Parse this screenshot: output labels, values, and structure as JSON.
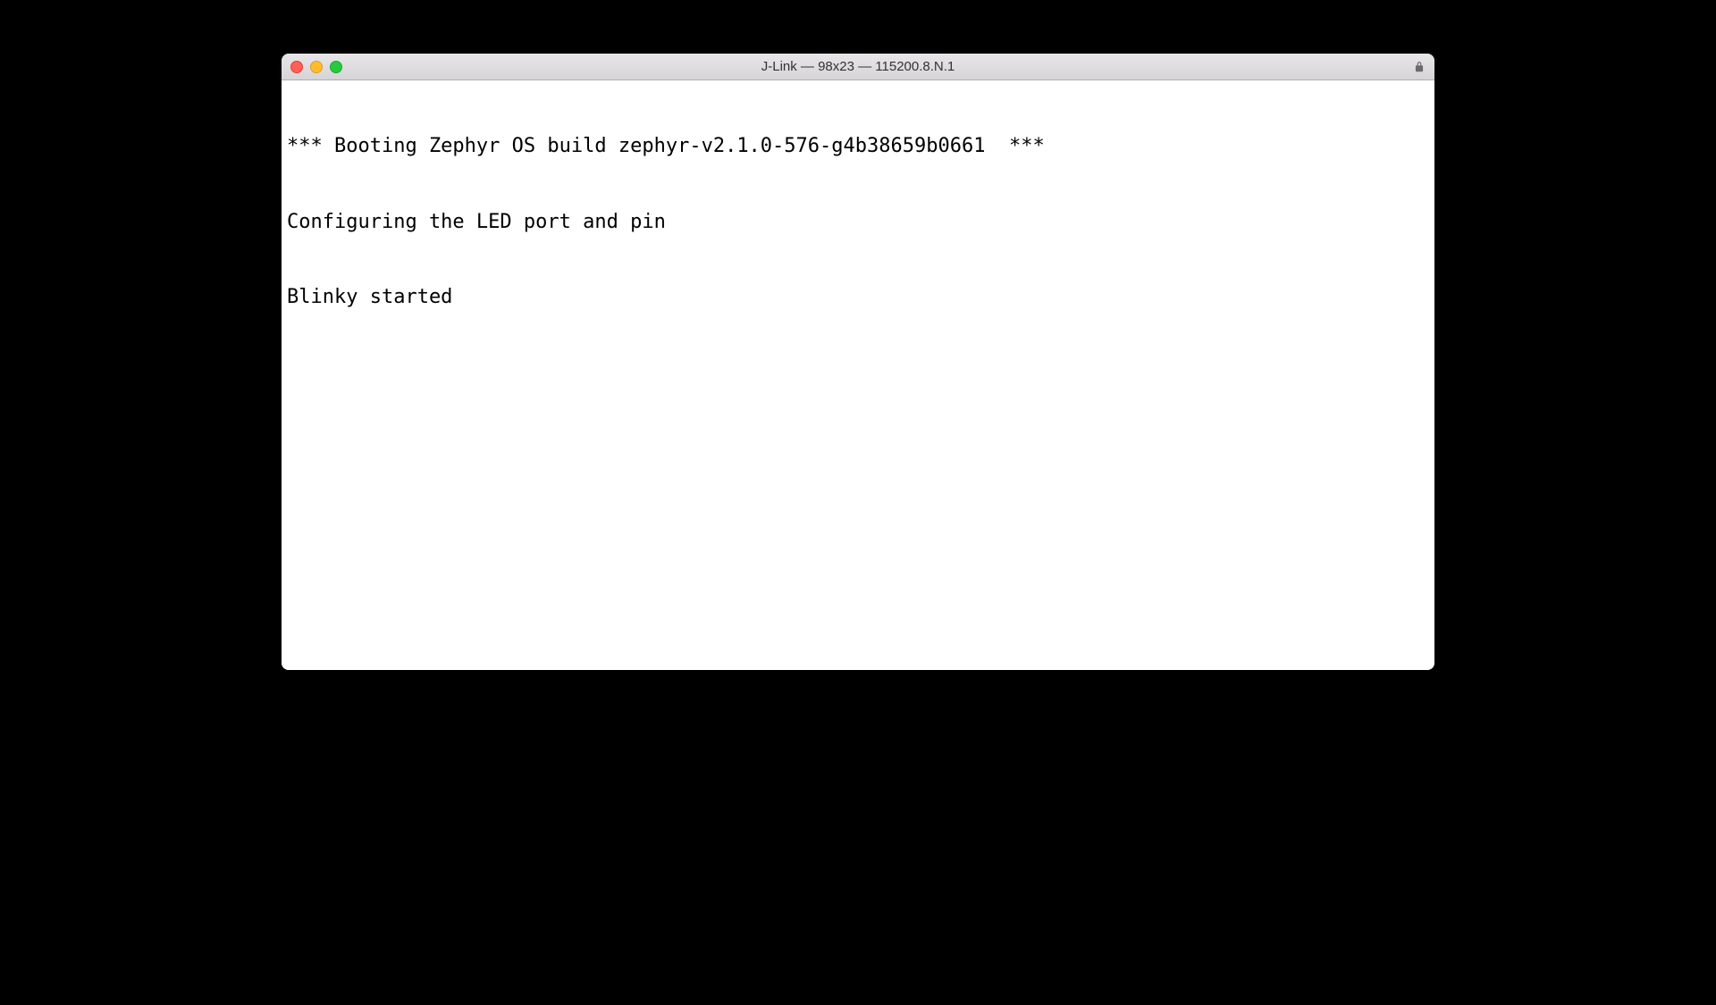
{
  "window": {
    "title": "J-Link — 98x23 — 115200.8.N.1"
  },
  "terminal": {
    "lines": [
      "*** Booting Zephyr OS build zephyr-v2.1.0-576-g4b38659b0661  ***",
      "Configuring the LED port and pin",
      "Blinky started"
    ]
  }
}
